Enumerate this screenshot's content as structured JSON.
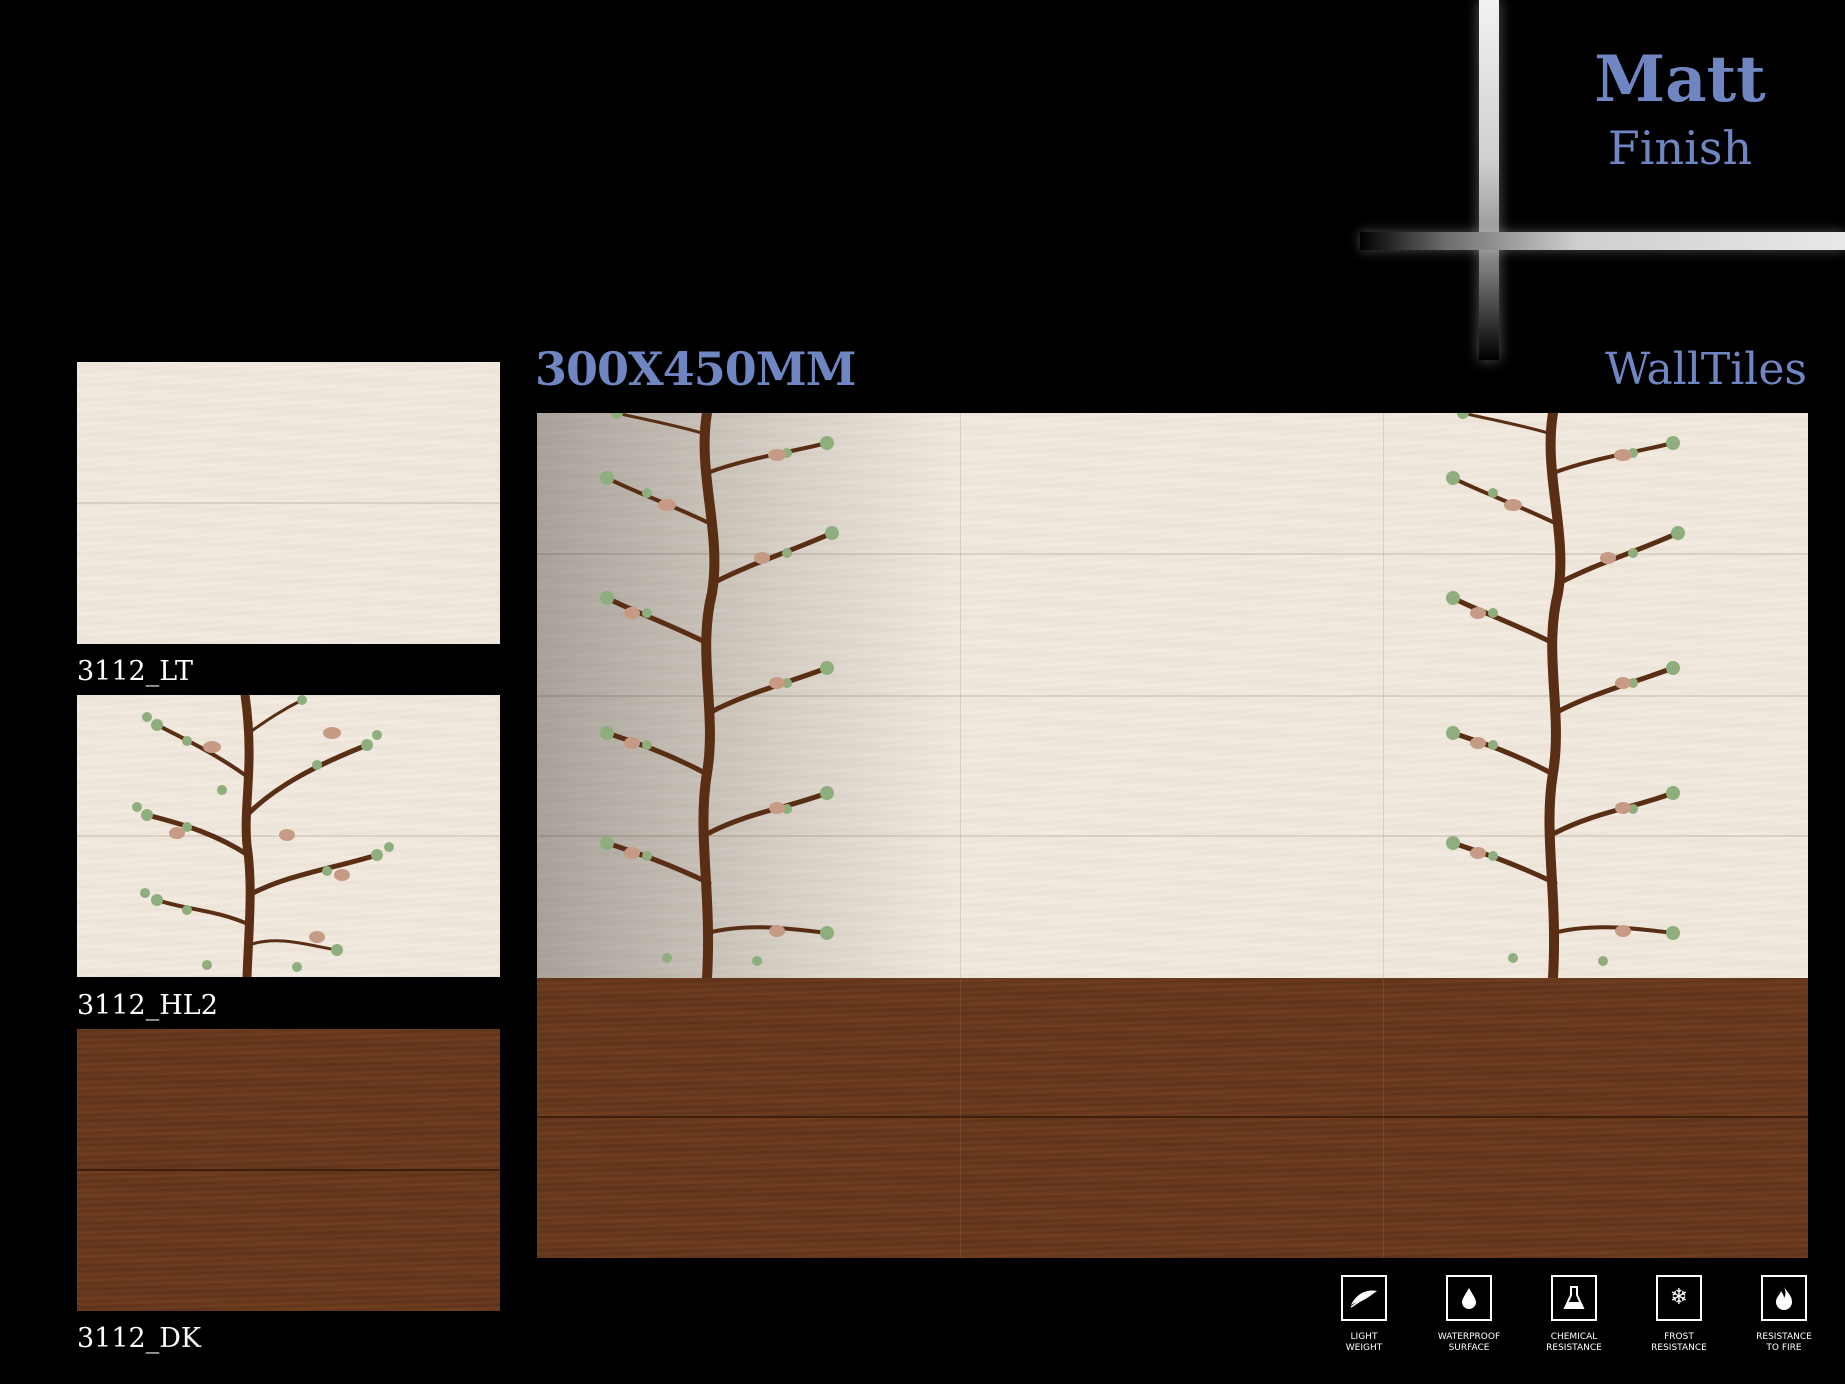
{
  "finish": {
    "title": "Matt",
    "subtitle": "Finish"
  },
  "size_label": "300X450MM",
  "type_label": "WallTiles",
  "tiles": [
    {
      "code": "3112_LT"
    },
    {
      "code": "3112_HL2"
    },
    {
      "code": "3112_DK"
    }
  ],
  "features": [
    {
      "label_line1": "LIGHT",
      "label_line2": "WEIGHT",
      "icon": "feather-icon"
    },
    {
      "label_line1": "WATERPROOF",
      "label_line2": "SURFACE",
      "icon": "water-drop-icon"
    },
    {
      "label_line1": "CHEMICAL",
      "label_line2": "RESISTANCE",
      "icon": "flask-icon"
    },
    {
      "label_line1": "FROST",
      "label_line2": "RESISTANCE",
      "icon": "snowflake-icon"
    },
    {
      "label_line1": "RESISTANCE",
      "label_line2": "TO FIRE",
      "icon": "flame-icon"
    }
  ],
  "colors": {
    "accent": "#6f86c2",
    "light_wood": "#f3ece3",
    "dark_wood": "#6a3a1e",
    "branch": "#5a2e14",
    "leaf": "#8fae7e",
    "bird": "#c79a86"
  }
}
